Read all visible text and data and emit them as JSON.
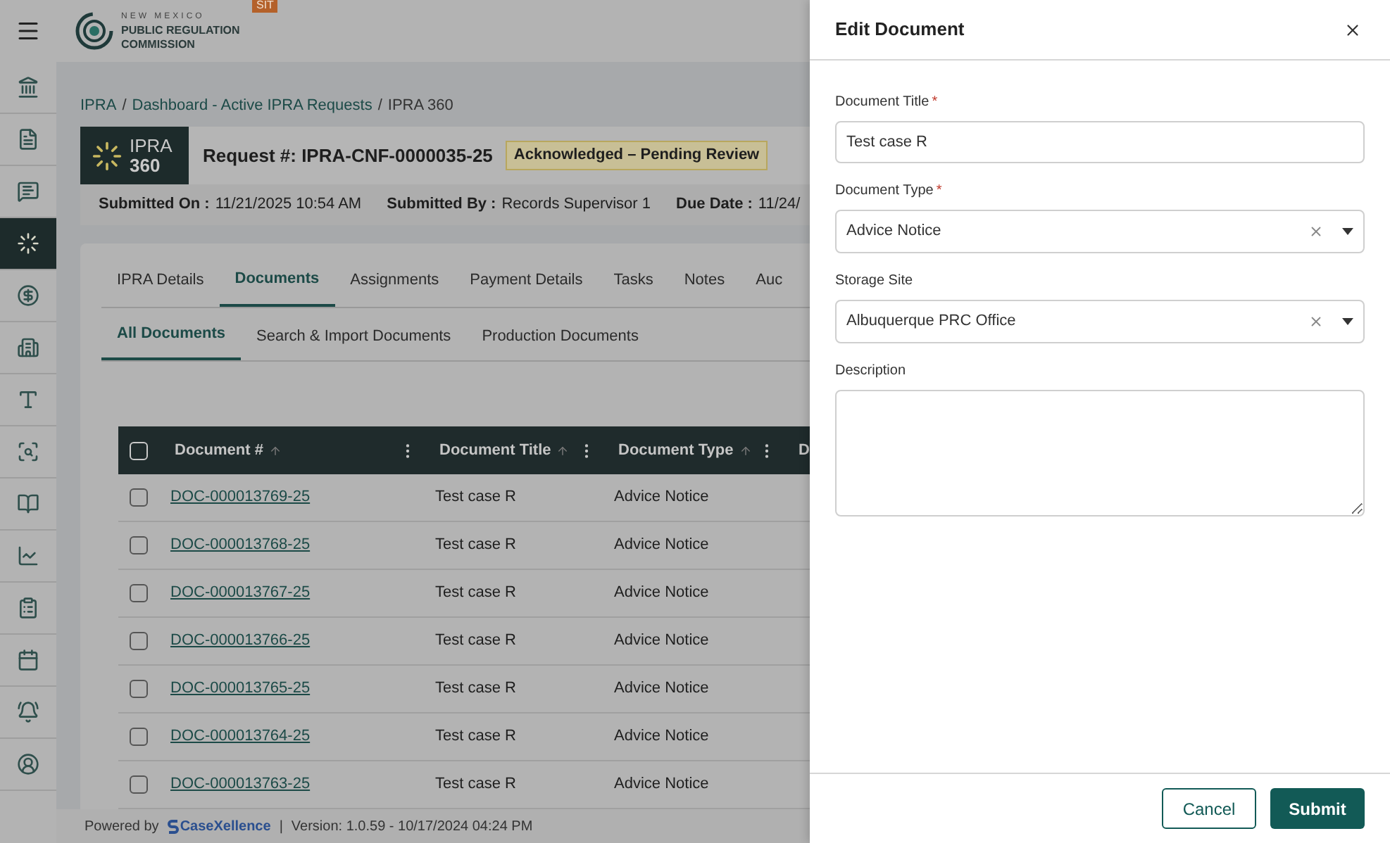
{
  "header": {
    "logo_top": "NEW MEXICO",
    "logo_main": "PUBLIC REGULATION",
    "logo_bottom": "COMMISSION",
    "env_badge": "SIT"
  },
  "sidebar": {
    "items": [
      {
        "selected": false
      },
      {
        "selected": false
      },
      {
        "selected": false
      },
      {
        "selected": true
      },
      {
        "selected": false
      },
      {
        "selected": false
      },
      {
        "selected": false
      },
      {
        "selected": false
      },
      {
        "selected": false
      },
      {
        "selected": false
      },
      {
        "selected": false
      },
      {
        "selected": false
      },
      {
        "selected": false
      },
      {
        "selected": false
      }
    ]
  },
  "breadcrumb": {
    "separator": "/",
    "items": [
      {
        "label": "IPRA",
        "link": true
      },
      {
        "label": "Dashboard - Active IPRA Requests",
        "link": true
      },
      {
        "label": "IPRA 360",
        "link": false
      }
    ]
  },
  "request": {
    "logo_line1": "IPRA",
    "logo_line2": "360",
    "title": "Request #: IPRA-CNF-0000035-25",
    "status": "Acknowledged – Pending Review",
    "meta": [
      {
        "label": "Submitted On :",
        "value": "11/21/2025 10:54 AM"
      },
      {
        "label": "Submitted By :",
        "value": "Records Supervisor 1"
      },
      {
        "label": "Due Date :",
        "value": "11/24/"
      }
    ]
  },
  "tabs": [
    {
      "label": "IPRA Details",
      "selected": false
    },
    {
      "label": "Documents",
      "selected": true
    },
    {
      "label": "Assignments",
      "selected": false
    },
    {
      "label": "Payment Details",
      "selected": false
    },
    {
      "label": "Tasks",
      "selected": false
    },
    {
      "label": "Notes",
      "selected": false
    },
    {
      "label": "Auc",
      "selected": false
    }
  ],
  "subtabs": [
    {
      "label": "All Documents",
      "selected": true
    },
    {
      "label": "Search & Import Documents",
      "selected": false
    },
    {
      "label": "Production Documents",
      "selected": false
    }
  ],
  "table": {
    "select_all_checked": false,
    "columns": [
      {
        "label": "Document #",
        "sortable": true,
        "menu": true
      },
      {
        "label": "Document Title",
        "sortable": true,
        "menu": true
      },
      {
        "label": "Document Type",
        "sortable": true,
        "menu": true
      },
      {
        "label": "D",
        "sortable": false,
        "menu": false
      }
    ],
    "rows": [
      {
        "checked": false,
        "doc": "DOC-000013769-25",
        "title": "Test case R",
        "type": "Advice Notice"
      },
      {
        "checked": false,
        "doc": "DOC-000013768-25",
        "title": "Test case R",
        "type": "Advice Notice"
      },
      {
        "checked": false,
        "doc": "DOC-000013767-25",
        "title": "Test case R",
        "type": "Advice Notice"
      },
      {
        "checked": false,
        "doc": "DOC-000013766-25",
        "title": "Test case R",
        "type": "Advice Notice"
      },
      {
        "checked": false,
        "doc": "DOC-000013765-25",
        "title": "Test case R",
        "type": "Advice Notice"
      },
      {
        "checked": false,
        "doc": "DOC-000013764-25",
        "title": "Test case R",
        "type": "Advice Notice"
      },
      {
        "checked": false,
        "doc": "DOC-000013763-25",
        "title": "Test case R",
        "type": "Advice Notice"
      }
    ]
  },
  "footer": {
    "powered_by": "Powered by",
    "brand": "CaseXellence",
    "separator": "|",
    "version": "Version: 1.0.59 - 10/17/2024 04:24 PM"
  },
  "drawer": {
    "title": "Edit Document",
    "fields": [
      {
        "kind": "text",
        "label": "Document Title",
        "required_mark": "*",
        "value": "Test case R"
      },
      {
        "kind": "select",
        "label": "Document Type",
        "required_mark": "*",
        "value": "Advice Notice",
        "clearable": true
      },
      {
        "kind": "select",
        "label": "Storage Site",
        "value": "Albuquerque PRC Office",
        "clearable": true
      },
      {
        "kind": "textarea",
        "label": "Description"
      }
    ],
    "buttons": [
      {
        "label": "Cancel",
        "kind": "secondary"
      },
      {
        "label": "Submit",
        "kind": "primary"
      }
    ]
  }
}
